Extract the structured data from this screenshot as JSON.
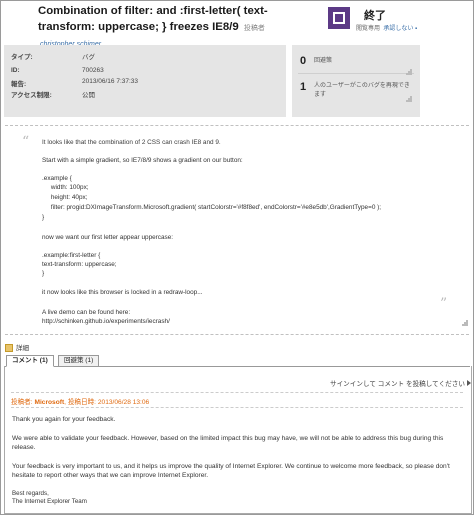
{
  "header": {
    "title": "Combination of filter: and :first-letter( text-transform: uppercase; } freezes IE8/9",
    "posted_by_label": "投稿者",
    "author": "christopher schimer",
    "status": "終了",
    "status_sub": "閲覧専用",
    "status_link": "承認しない"
  },
  "info": {
    "rows": [
      {
        "label": "タイプ:",
        "value": "バグ"
      },
      {
        "label": "ID:",
        "value": "700263"
      },
      {
        "label": "報告:",
        "value": "2013/06/16 7:37:33"
      },
      {
        "label": "アクセス制限:",
        "value": "公開"
      }
    ]
  },
  "votes": {
    "rows": [
      {
        "count": "0",
        "text": "回避策"
      },
      {
        "count": "1",
        "text": "人のユーザーがこのバグを再現できます"
      }
    ]
  },
  "description": {
    "lines": [
      "It looks like that the combination of 2 CSS can crash IE8 and 9.",
      "",
      "Start with a simple gradient, so IE7/8/9 shows a gradient on our button:",
      "",
      ".example {",
      "     width: 100px;",
      "     height: 40px;",
      "     filter: progid:DXImageTransform.Microsoft.gradient( startColorstr='#f8f8ed', endColorstr='#e8e5db',GradientType=0 );",
      "}",
      "",
      "now we want our first letter appear uppercase:",
      "",
      ".example:first-letter {",
      "text-transform: uppercase;",
      "}",
      "",
      "it now looks like this browser is locked in a redraw-loop...",
      "",
      "A live demo can be found here:",
      "http://schinken.github.io/experiments/iecrash/"
    ]
  },
  "tabs": {
    "detail_label": "詳細",
    "items": [
      {
        "label": "コメント (1)",
        "active": true
      },
      {
        "label": "回避策 (1)",
        "active": false
      }
    ]
  },
  "comments": {
    "signin_text": "サインインして コメント を投稿してください",
    "item": {
      "poster_label": "投稿者:",
      "poster": "Microsoft",
      "date_label": "投稿日時:",
      "date": "2013/06/28 13:06",
      "paragraphs": [
        "Thank you again for your feedback.",
        "We were able to validate your feedback. However, based on the limited impact this bug may have, we will not be able to address this bug during this release.",
        "Your feedback is very important to us, and it helps us improve the quality of Internet Explorer. We continue to welcome more feedback, so please don't hesitate to report other ways that we can improve Internet Explorer.",
        "Best regards,\nThe Internet Explorer Team"
      ]
    }
  },
  "colors": {
    "status_purple": "#5c3a86",
    "comment_orange": "#e06a10",
    "link_blue": "#3a6fa8",
    "panel_gray": "#e5e5e5"
  }
}
